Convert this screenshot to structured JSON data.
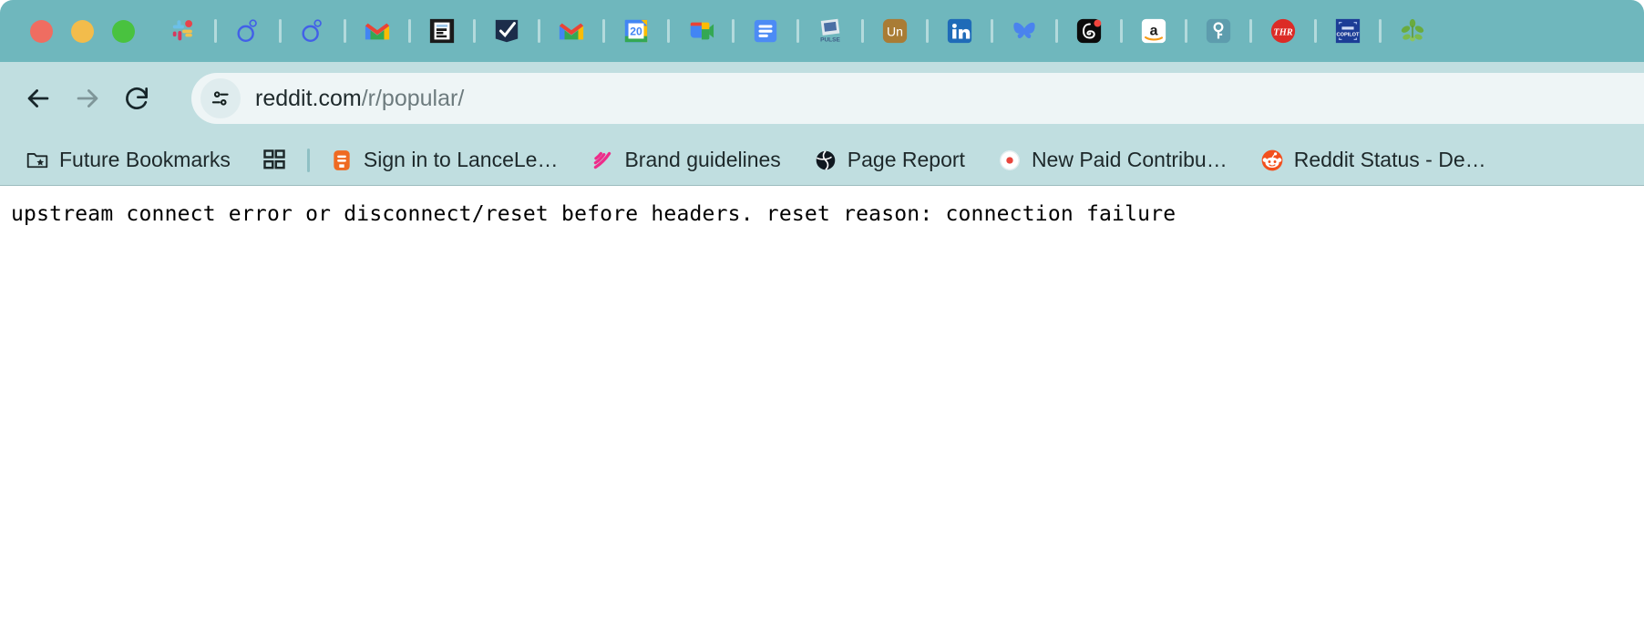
{
  "window": {
    "traffic_lights": [
      {
        "name": "close",
        "color": "#ef6d61"
      },
      {
        "name": "minimize",
        "color": "#f3bc4b"
      },
      {
        "name": "maximize",
        "color": "#49c23f"
      }
    ],
    "chrome_colors": {
      "tabstrip": "#6fb7bd",
      "toolbar": "#c0dee0",
      "omnibox": "#eef5f6",
      "bookmarks_bar": "#c0dee0",
      "page": "#ffffff"
    }
  },
  "tabs": [
    {
      "icon": "slack-icon",
      "title": "Slack"
    },
    {
      "icon": "asana-icon",
      "title": "Asana"
    },
    {
      "icon": "asana-icon",
      "title": "Asana"
    },
    {
      "icon": "gmail-icon",
      "title": "Gmail"
    },
    {
      "icon": "e-document-icon",
      "title": "E"
    },
    {
      "icon": "checkmark-navy-icon",
      "title": "Checkmark"
    },
    {
      "icon": "gmail-icon",
      "title": "Gmail"
    },
    {
      "icon": "google-calendar-icon",
      "title": "Google Calendar",
      "label": "20"
    },
    {
      "icon": "google-meet-icon",
      "title": "Google Meet"
    },
    {
      "icon": "google-docs-icon",
      "title": "Google Docs"
    },
    {
      "icon": "pulse-icon",
      "title": "Pulse",
      "label": "PULSE"
    },
    {
      "icon": "unsplash-icon",
      "title": "Unsplash",
      "label": "Un"
    },
    {
      "icon": "linkedin-icon",
      "title": "LinkedIn",
      "label": "in"
    },
    {
      "icon": "bluesky-icon",
      "title": "Bluesky"
    },
    {
      "icon": "threads-icon",
      "title": "Threads"
    },
    {
      "icon": "amazon-icon",
      "title": "Amazon",
      "label": "a"
    },
    {
      "icon": "key-icon",
      "title": "Password Manager"
    },
    {
      "icon": "thr-icon",
      "title": "The Hollywood Reporter",
      "label": "THR"
    },
    {
      "icon": "copilot-icon",
      "title": "Copilot",
      "label": "COPILOT"
    },
    {
      "icon": "plant-icon",
      "title": "Plant"
    }
  ],
  "toolbar": {
    "back_label": "Back",
    "forward_label": "Forward",
    "reload_label": "Reload",
    "site_info_label": "View site information",
    "url_domain": "reddit.com",
    "url_path": "/r/popular/",
    "url_full": "reddit.com/r/popular/"
  },
  "bookmarks": {
    "items": [
      {
        "label": "Future Bookmarks",
        "icon": "folder-star-icon"
      },
      {
        "label": "Sign in to LanceLe…",
        "icon": "orange-bookmark-icon"
      },
      {
        "label": "Brand guidelines",
        "icon": "pink-rss-icon"
      },
      {
        "label": "Page Report",
        "icon": "globe-icon"
      },
      {
        "label": "New Paid Contribu…",
        "icon": "red-dot-icon"
      },
      {
        "label": "Reddit Status - De…",
        "icon": "reddit-icon"
      }
    ],
    "apps_grid_label": "All Bookmarks"
  },
  "page": {
    "error_text": "upstream connect error or disconnect/reset before headers. reset reason: connection failure"
  }
}
